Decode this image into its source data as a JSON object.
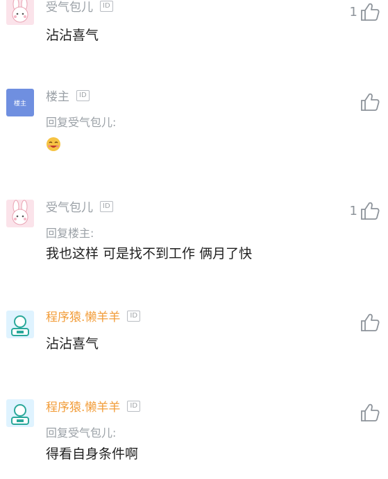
{
  "comments": [
    {
      "name": "受气包儿",
      "id_badge": "ID",
      "reply_to": "",
      "content": "沾沾喜气",
      "likes": "1",
      "avatar": "bunny-avatar"
    },
    {
      "name": "楼主",
      "id_badge": "ID",
      "reply_to": "回复受气包儿:",
      "content": "",
      "likes": "",
      "avatar": "owner-avatar",
      "avatar_text": "楼主",
      "emoji": "laughing-face-emoji"
    },
    {
      "name": "受气包儿",
      "id_badge": "ID",
      "reply_to": "回复楼主:",
      "content": "我也这样 可是找不到工作 俩月了快",
      "likes": "1",
      "avatar": "bunny-avatar"
    },
    {
      "name": "程序猿.懒羊羊",
      "id_badge": "ID",
      "reply_to": "",
      "content": "沾沾喜气",
      "likes": "",
      "avatar": "coder-avatar"
    },
    {
      "name": "程序猿.懒羊羊",
      "id_badge": "ID",
      "reply_to": "回复受气包儿:",
      "content": "得看自身条件啊",
      "likes": "",
      "avatar": "coder-avatar"
    }
  ],
  "colors": {
    "username": "#9aa0a6",
    "vip_username": "#f29c38",
    "content_text": "#1f1f1f",
    "like_icon": "#8d939a"
  },
  "icons": {
    "like": "thumbs-up-icon",
    "id": "id-badge"
  }
}
